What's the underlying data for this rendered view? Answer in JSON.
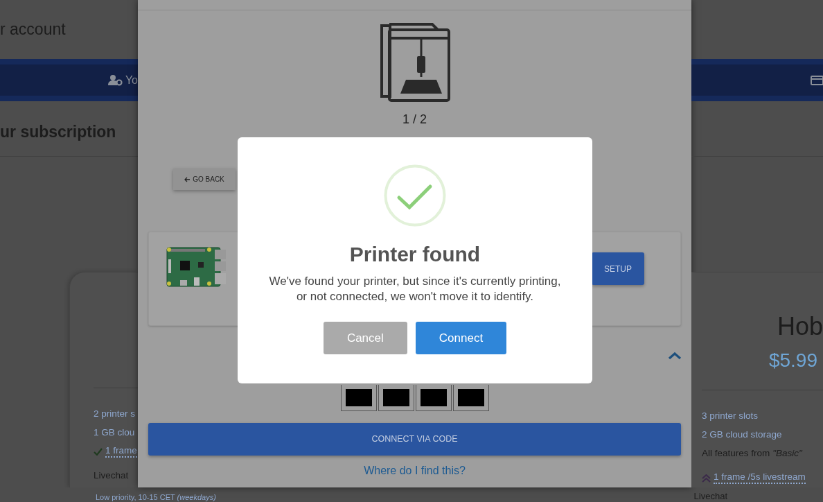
{
  "background_page": {
    "page_title": "r account",
    "nav_items": [
      {
        "label": "Yo"
      }
    ],
    "section_title": "ur subscription",
    "plans": [
      {
        "features": [
          {
            "text": "2 printer s",
            "kind": "plain"
          },
          {
            "text": "1 GB clou",
            "kind": "plain"
          },
          {
            "text": "1 frame",
            "kind": "check"
          },
          {
            "text": "Livechat",
            "kind": "plain"
          }
        ],
        "note": "Low priority, 10-15 CET *(weekdays)*"
      },
      {
        "name": "Hob",
        "price": "$5.99",
        "features": [
          {
            "text": "3 printer slots",
            "kind": "plain"
          },
          {
            "text": "2 GB cloud storage",
            "kind": "plain"
          },
          {
            "text": "All features from *\"Basic\"*",
            "kind": "plain"
          },
          {
            "text": "1 frame /5s livestream",
            "kind": "upgrade"
          }
        ],
        "note": "Livechat"
      }
    ]
  },
  "setup_panel": {
    "step": "1 / 2",
    "back_button": "GO BACK",
    "device_button": "SETUP",
    "expanded": true,
    "connect_button": "CONNECT VIA CODE",
    "help_link": "Where do I find this?"
  },
  "dialog": {
    "title": "Printer found",
    "message": "We've found your printer, but since it's currently printing, or not connected, we won't move it to identify.",
    "buttons": [
      {
        "label": "Cancel",
        "kind": "secondary"
      },
      {
        "label": "Connect",
        "kind": "primary"
      }
    ]
  }
}
